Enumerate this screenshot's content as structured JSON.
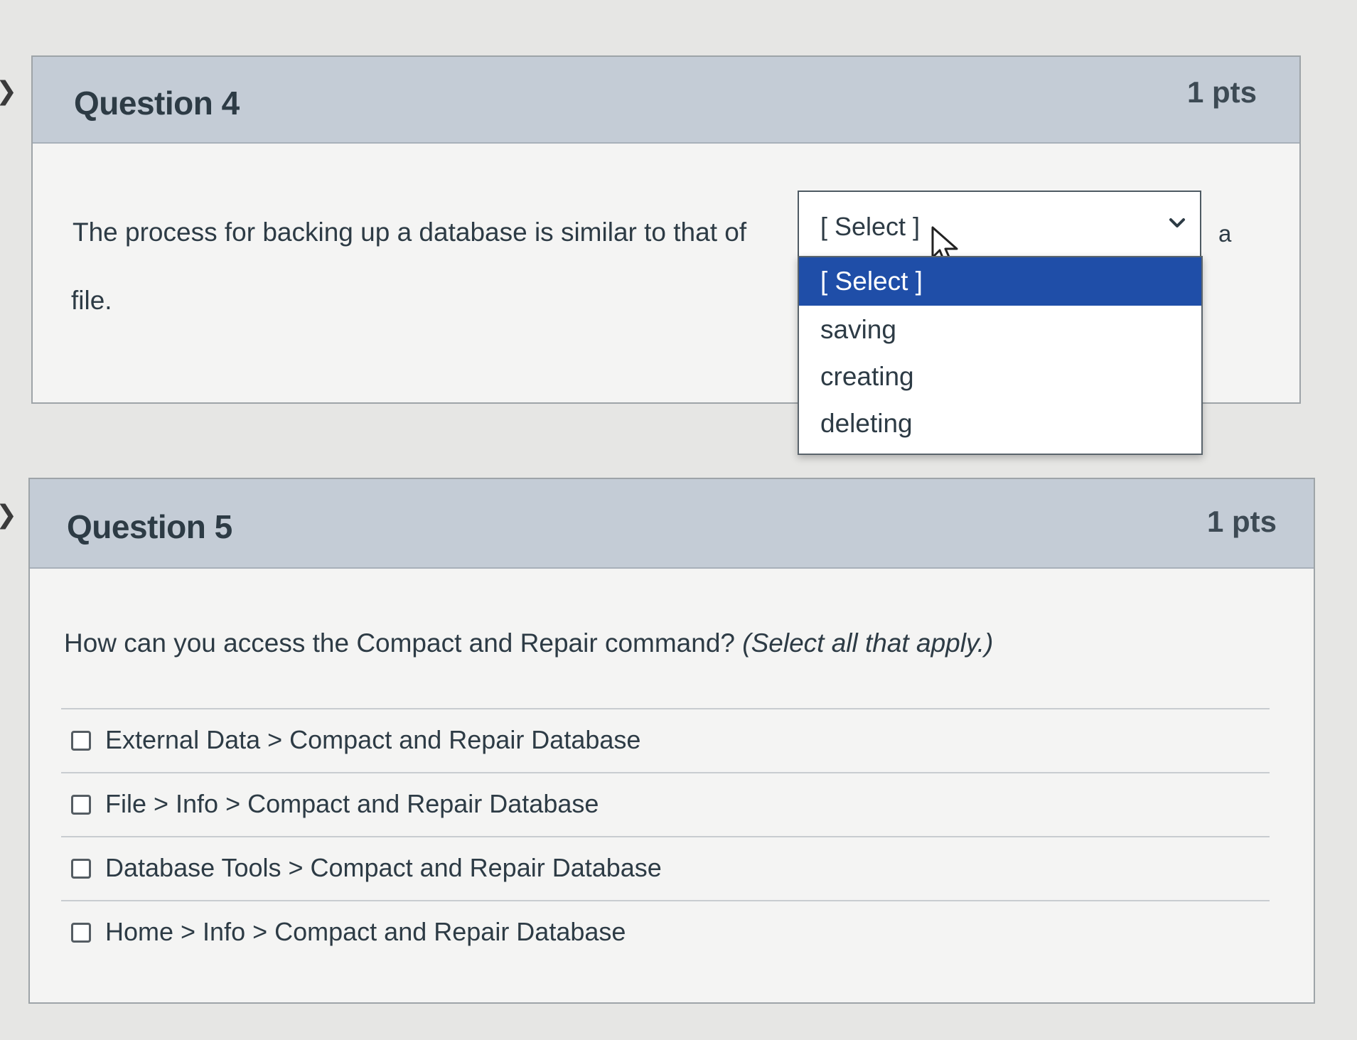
{
  "question4": {
    "title": "Question 4",
    "points": "1 pts",
    "text_before": "The process for backing up a database is similar to that of",
    "text_trailing": "a",
    "text_after": "file.",
    "select": {
      "current_value": "[ Select ]",
      "is_open": true,
      "options": [
        "[ Select ]",
        "saving",
        "creating",
        "deleting"
      ],
      "highlighted_option": "[ Select ]"
    }
  },
  "question5": {
    "title": "Question 5",
    "points": "1 pts",
    "prompt": "How can you access the Compact and Repair command?",
    "prompt_hint": "(Select all that apply.)",
    "answers": [
      {
        "label": "External Data > Compact and Repair Database",
        "checked": false
      },
      {
        "label": "File > Info > Compact and Repair Database",
        "checked": false
      },
      {
        "label": "Database Tools > Compact and Repair Database",
        "checked": false
      },
      {
        "label": "Home > Info > Compact and Repair Database",
        "checked": false
      }
    ]
  },
  "colors": {
    "header_bg": "#c4ccd6",
    "option_highlight": "#1f4ea8",
    "text": "#2d3b45"
  },
  "icons": {
    "nav": "chevron-right-icon",
    "select": "chevron-down-icon",
    "cursor": "mouse-pointer-icon"
  }
}
